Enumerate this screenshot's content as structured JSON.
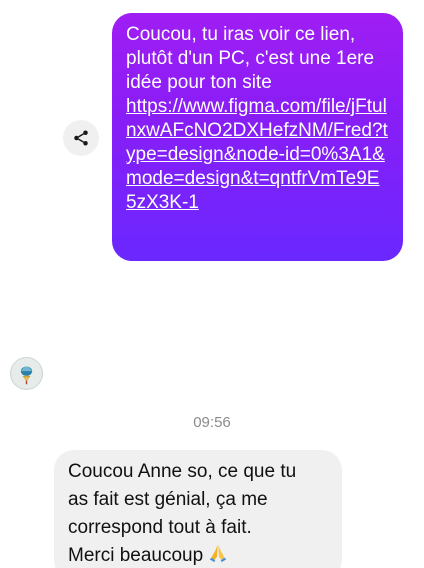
{
  "outgoing_message": {
    "text": "Coucou, tu iras voir ce lien, plutôt d'un PC, c'est une 1ere idée pour ton site",
    "link": "https://www.figma.com/file/jFtulnxwAFcNO2DXHefzNM/Fred?type=design&node-id=0%3A1&mode=design&t=qntfrVmTe9E5zX3K-1",
    "gradient_colors": [
      "#9f1ef4",
      "#6a28ff"
    ]
  },
  "share_button": {
    "icon": "share-icon"
  },
  "contact": {
    "avatar_icon": "avatar"
  },
  "timestamp": "09:56",
  "incoming_message": {
    "lines": [
      "Coucou Anne so,  ce que tu",
      "as fait est génial,  ça me",
      "correspond tout à fait.",
      "Merci beaucoup"
    ],
    "emoji": "pray-emoji-icon"
  }
}
